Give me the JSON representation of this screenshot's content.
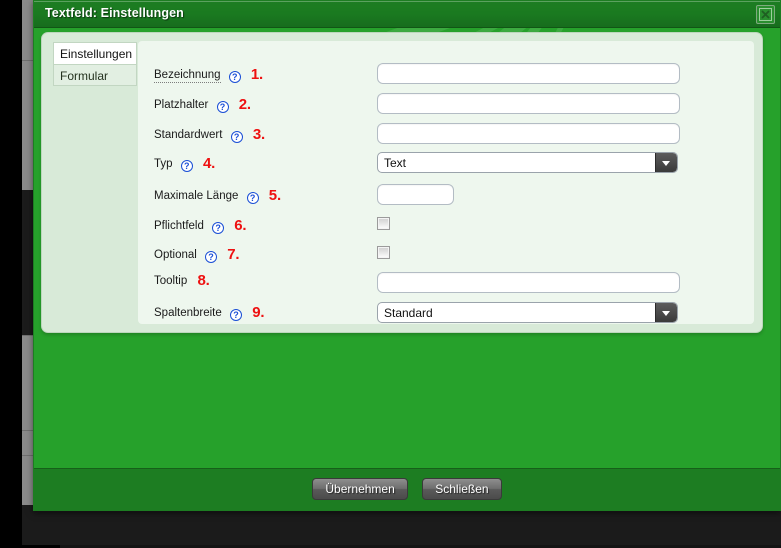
{
  "window": {
    "title": "Textfeld: Einstellungen",
    "close_icon": "close-x-icon"
  },
  "tabs": [
    {
      "label": "Einstellungen",
      "active": true
    },
    {
      "label": "Formular",
      "active": false
    }
  ],
  "form": {
    "help_glyph": "?",
    "rows": [
      {
        "label": "Bezeichnung",
        "help": true,
        "number": "1.",
        "control": "text",
        "value": "",
        "dotted": true
      },
      {
        "label": "Platzhalter",
        "help": true,
        "number": "2.",
        "control": "text",
        "value": "",
        "dotted": false
      },
      {
        "label": "Standardwert",
        "help": true,
        "number": "3.",
        "control": "text",
        "value": "",
        "dotted": false
      },
      {
        "label": "Typ",
        "help": true,
        "number": "4.",
        "control": "select",
        "value": "Text",
        "dotted": false
      },
      {
        "label": "Maximale Länge",
        "help": true,
        "number": "5.",
        "control": "text-sm",
        "value": "",
        "dotted": false
      },
      {
        "label": "Pflichtfeld",
        "help": true,
        "number": "6.",
        "control": "checkbox",
        "value": "unchecked",
        "dotted": false
      },
      {
        "label": "Optional",
        "help": true,
        "number": "7.",
        "control": "checkbox",
        "value": "unchecked",
        "dotted": false
      },
      {
        "label": "Tooltip",
        "help": false,
        "number": "8.",
        "control": "text",
        "value": "",
        "dotted": false
      },
      {
        "label": "Spaltenbreite",
        "help": true,
        "number": "9.",
        "control": "select",
        "value": "Standard",
        "dotted": false
      }
    ]
  },
  "footer": {
    "apply_label": "Übernehmen",
    "close_label": "Schließen"
  },
  "colors": {
    "dialog_green": "#26a12b",
    "titlebar_green": "#1d7d22",
    "panel_green": "#d8ead8",
    "panel_inner": "#eef7ee",
    "number_red": "#ee1111",
    "help_blue": "#1a4fd6"
  }
}
